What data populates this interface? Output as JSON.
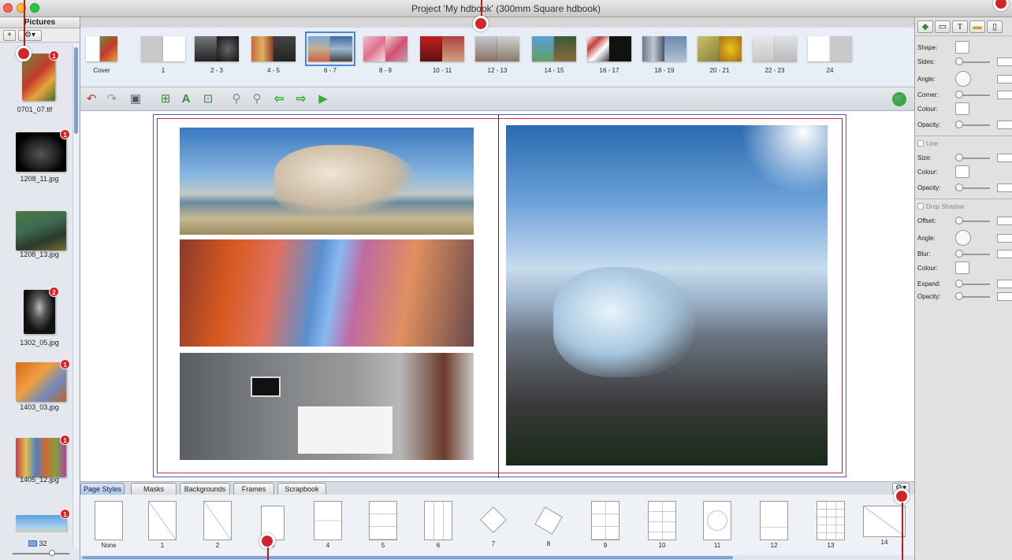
{
  "window": {
    "title": "Project 'My hdbook' (300mm Square hdbook)",
    "colors": {
      "close": "#ff5f57",
      "minimize": "#febc2e",
      "zoom": "#28c840",
      "accent": "#4a86d6",
      "callout": "#d0262a"
    }
  },
  "pictures": {
    "header": "Pictures",
    "add_icon": "plus-icon",
    "gear_icon": "gear-icon",
    "items": [
      {
        "name": "0701_07.tif",
        "badge": "1"
      },
      {
        "name": "1208_11.jpg",
        "badge": "1"
      },
      {
        "name": "1208_13.jpg",
        "badge": ""
      },
      {
        "name": "1302_05.jpg",
        "badge": "2"
      },
      {
        "name": "1403_03.jpg",
        "badge": "1"
      },
      {
        "name": "1405_12.jpg",
        "badge": "1"
      },
      {
        "name": "",
        "badge": "1"
      }
    ],
    "count": "32"
  },
  "page_strip": [
    {
      "label": "Cover"
    },
    {
      "label": "1"
    },
    {
      "label": "2 - 3"
    },
    {
      "label": "4 - 5"
    },
    {
      "label": "6 - 7",
      "selected": true
    },
    {
      "label": "8 - 9"
    },
    {
      "label": "10 - 11"
    },
    {
      "label": "12 - 13"
    },
    {
      "label": "14 - 15"
    },
    {
      "label": "16 - 17"
    },
    {
      "label": "18 - 19"
    },
    {
      "label": "20 - 21"
    },
    {
      "label": "22 - 23"
    },
    {
      "label": "24"
    }
  ],
  "toolbar": {
    "icons": [
      "undo-icon",
      "redo-icon",
      "save-icon",
      "add-picture-icon",
      "add-text-icon",
      "add-page-icon",
      "zoom-out-icon",
      "zoom-in-icon",
      "previous-page-icon",
      "next-page-icon",
      "play-icon",
      "cart-icon"
    ]
  },
  "tabs": [
    "Page Styles",
    "Masks",
    "Backgrounds",
    "Frames",
    "Scrapbook"
  ],
  "page_styles": [
    {
      "label": "None"
    },
    {
      "label": "1"
    },
    {
      "label": "2"
    },
    {
      "label": "3"
    },
    {
      "label": "4"
    },
    {
      "label": "5"
    },
    {
      "label": "6"
    },
    {
      "label": "7"
    },
    {
      "label": "8"
    },
    {
      "label": "9"
    },
    {
      "label": "10"
    },
    {
      "label": "11"
    },
    {
      "label": "12"
    },
    {
      "label": "13"
    },
    {
      "label": "14"
    }
  ],
  "inspector": {
    "tabs": [
      "shapes-icon",
      "frame-icon",
      "T",
      "ruler-icon",
      "page-icon"
    ],
    "shape": {
      "shape": "Shape:",
      "sides": "Sides:",
      "angle": "Angle:",
      "corner": "Corner:",
      "colour": "Colour:",
      "opacity": "Opacity:"
    },
    "line": {
      "title": "Line",
      "size": "Size:",
      "colour": "Colour:",
      "opacity": "Opacity:"
    },
    "shadow": {
      "title": "Drop Shadow",
      "offset": "Offset:",
      "angle": "Angle:",
      "blur": "Blur:",
      "colour": "Colour:",
      "expand": "Expand:",
      "opacity": "Opacity:"
    }
  }
}
